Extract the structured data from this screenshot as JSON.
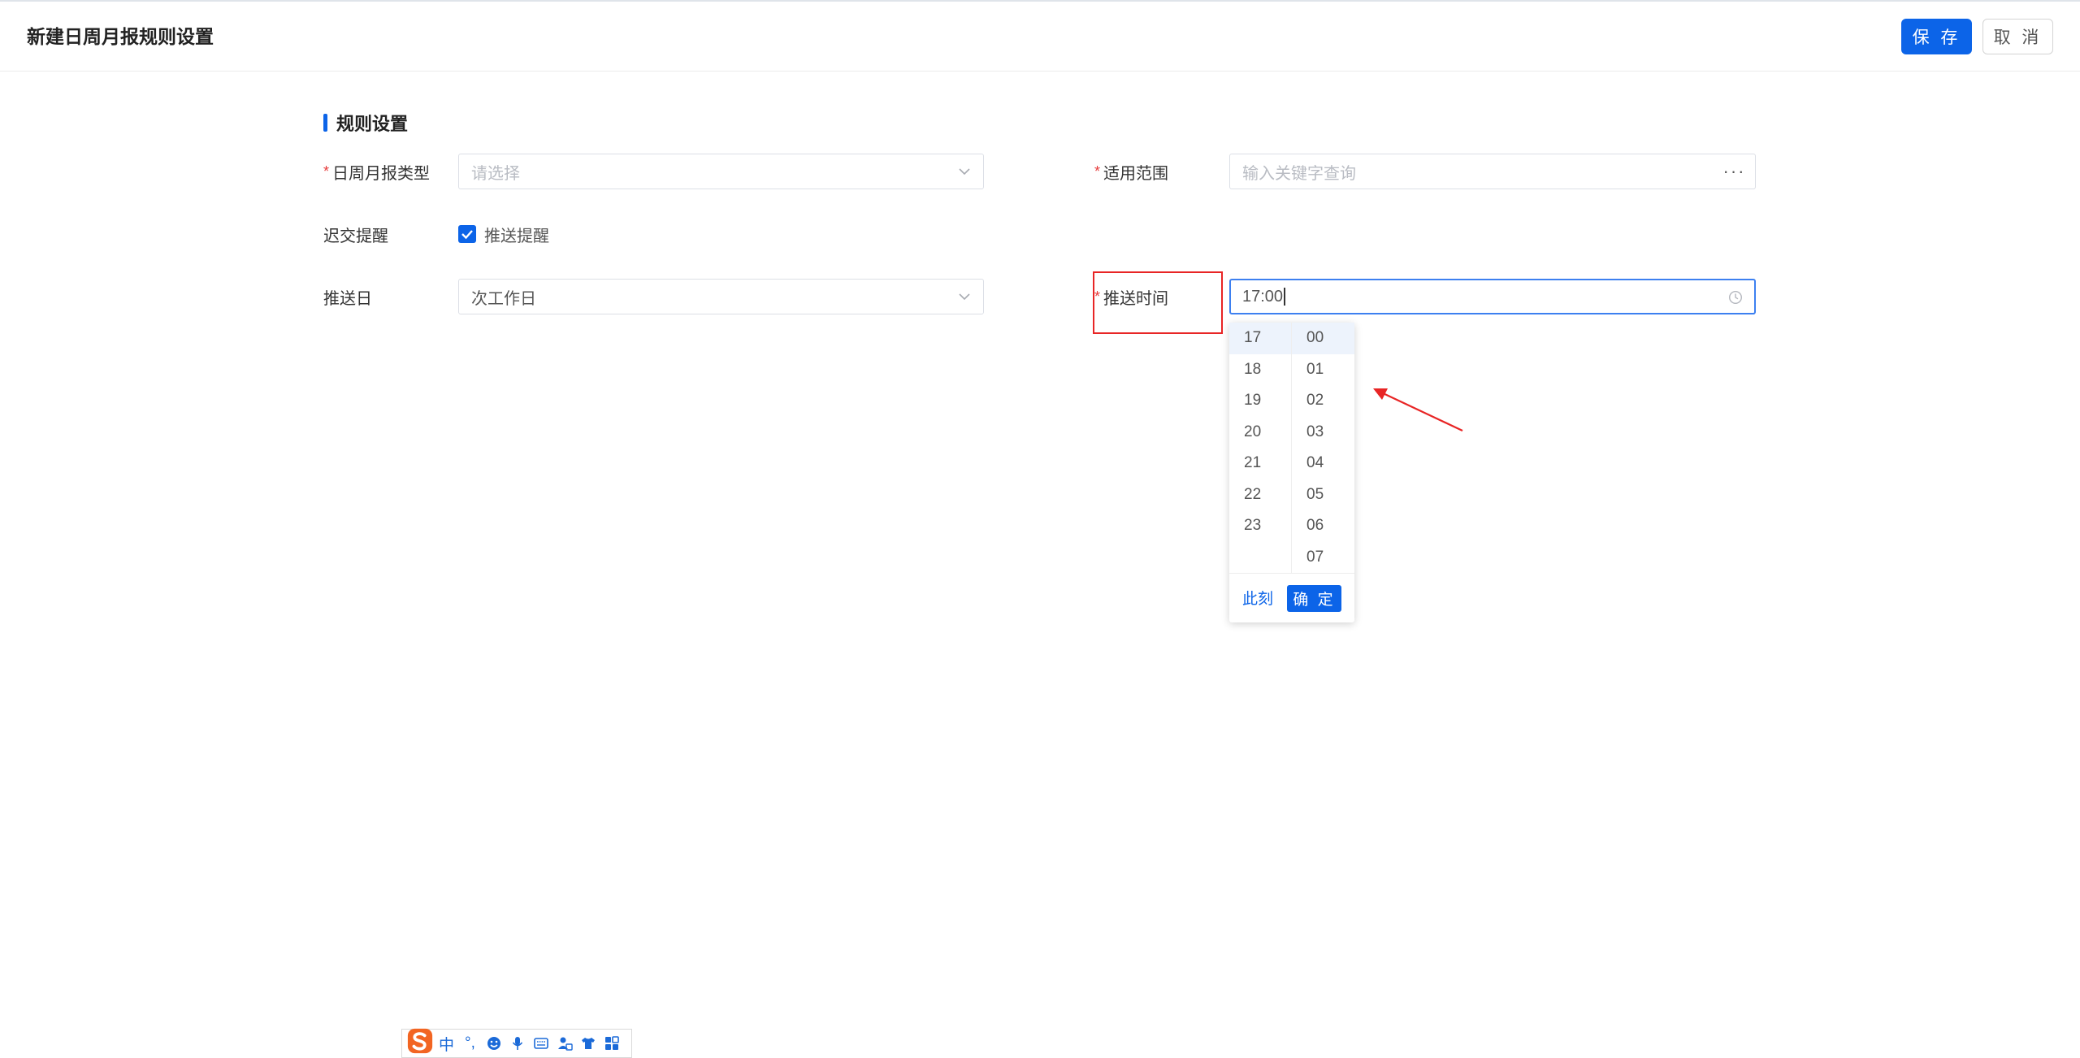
{
  "header": {
    "title": "新建日周月报规则设置",
    "save_label": "保 存",
    "cancel_label": "取 消"
  },
  "section": {
    "title": "规则设置"
  },
  "form": {
    "report_type": {
      "label": "日周月报类型",
      "required_mark": "*",
      "placeholder": "请选择"
    },
    "scope": {
      "label": "适用范围",
      "required_mark": "*",
      "placeholder": "输入关键字查询",
      "more_label": "···"
    },
    "late_reminder": {
      "label": "迟交提醒",
      "checkbox_label": "推送提醒",
      "checked": true
    },
    "push_day": {
      "label": "推送日",
      "value": "次工作日"
    },
    "push_time": {
      "label": "推送时间",
      "required_mark": "*",
      "value": "17:00"
    }
  },
  "time_picker": {
    "hours": [
      "17",
      "18",
      "19",
      "20",
      "21",
      "22",
      "23"
    ],
    "minutes": [
      "00",
      "01",
      "02",
      "03",
      "04",
      "05",
      "06",
      "07"
    ],
    "selected_hour": "17",
    "selected_minute": "00",
    "now_label": "此刻",
    "ok_label": "确 定"
  },
  "colors": {
    "primary": "#0c64e8",
    "required": "#e63b3b",
    "annotation": "#e82525",
    "ime_logo": "#f26522"
  },
  "ime_toolbar": {
    "mode_label": "中",
    "punct_label": "°,",
    "icons": [
      "emoji-icon",
      "microphone-icon",
      "keyboard-icon",
      "user-icon",
      "skin-icon",
      "toolbox-icon"
    ]
  }
}
